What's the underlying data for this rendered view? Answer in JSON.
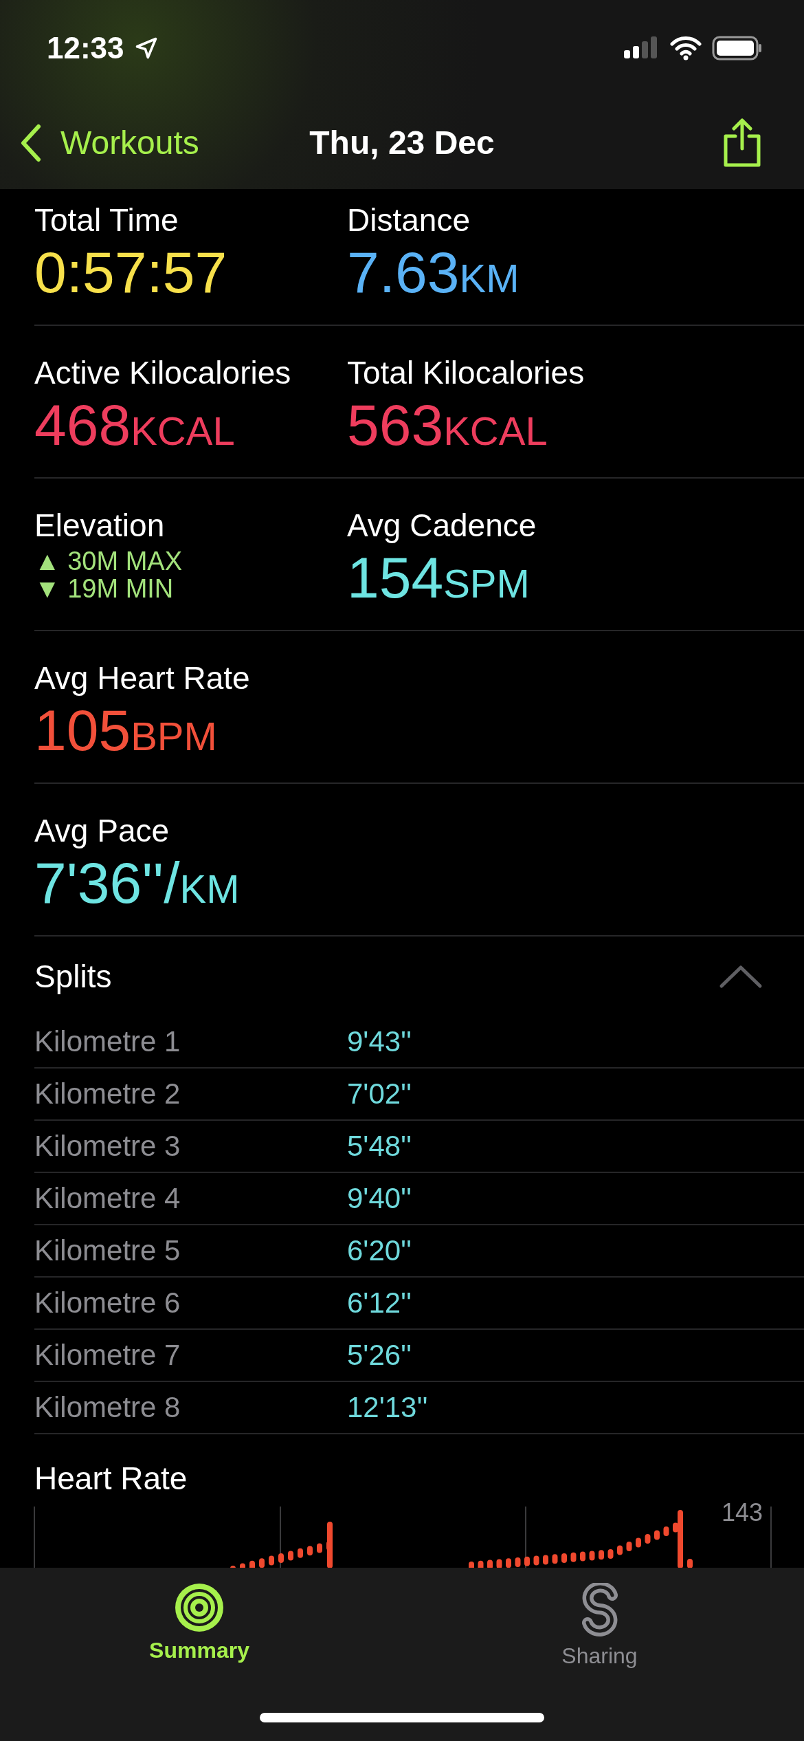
{
  "status_bar": {
    "time": "12:33"
  },
  "nav": {
    "back": "Workouts",
    "title": "Thu, 23 Dec"
  },
  "metric_rows": [
    [
      {
        "label": "Total Time",
        "kind": "value",
        "value": "0:57:57",
        "color": "#f7e04b"
      },
      {
        "label": "Distance",
        "kind": "value",
        "value": "7.63",
        "unit": "KM",
        "color": "#5ab2f6"
      }
    ],
    [
      {
        "label": "Active Kilocalories",
        "kind": "value",
        "value": "468",
        "unit": "KCAL",
        "color": "#ee3d5d"
      },
      {
        "label": "Total Kilocalories",
        "kind": "value",
        "value": "563",
        "unit": "KCAL",
        "color": "#ee3d5d"
      }
    ],
    [
      {
        "label": "Elevation",
        "kind": "range",
        "lines": [
          "▲ 30M MAX",
          "▼ 19M MIN"
        ],
        "color": "#a3e27c"
      },
      {
        "label": "Avg Cadence",
        "kind": "value",
        "value": "154",
        "unit": "SPM",
        "color": "#6ee4e2"
      }
    ],
    [
      {
        "label": "Avg Heart Rate",
        "kind": "value",
        "value": "105",
        "unit": "BPM",
        "color": "#f2503a"
      }
    ],
    [
      {
        "label": "Avg Pace",
        "kind": "value",
        "value": "7'36''/",
        "unit": "KM",
        "color": "#6ee4e2"
      }
    ]
  ],
  "splits": {
    "title": "Splits",
    "expanded": true,
    "rows": [
      {
        "label": "Kilometre 1",
        "time": "9'43''"
      },
      {
        "label": "Kilometre 2",
        "time": "7'02''"
      },
      {
        "label": "Kilometre 3",
        "time": "5'48''"
      },
      {
        "label": "Kilometre 4",
        "time": "9'40''"
      },
      {
        "label": "Kilometre 5",
        "time": "6'20''"
      },
      {
        "label": "Kilometre 6",
        "time": "6'12''"
      },
      {
        "label": "Kilometre 7",
        "time": "5'26''"
      },
      {
        "label": "Kilometre 8",
        "time": "12'13''"
      }
    ]
  },
  "heart_rate": {
    "title": "Heart Rate",
    "max_label": "143"
  },
  "tabs": [
    {
      "label": "Summary",
      "kind": "summary",
      "selected": true
    },
    {
      "label": "Sharing",
      "kind": "sharing",
      "selected": false
    }
  ]
}
